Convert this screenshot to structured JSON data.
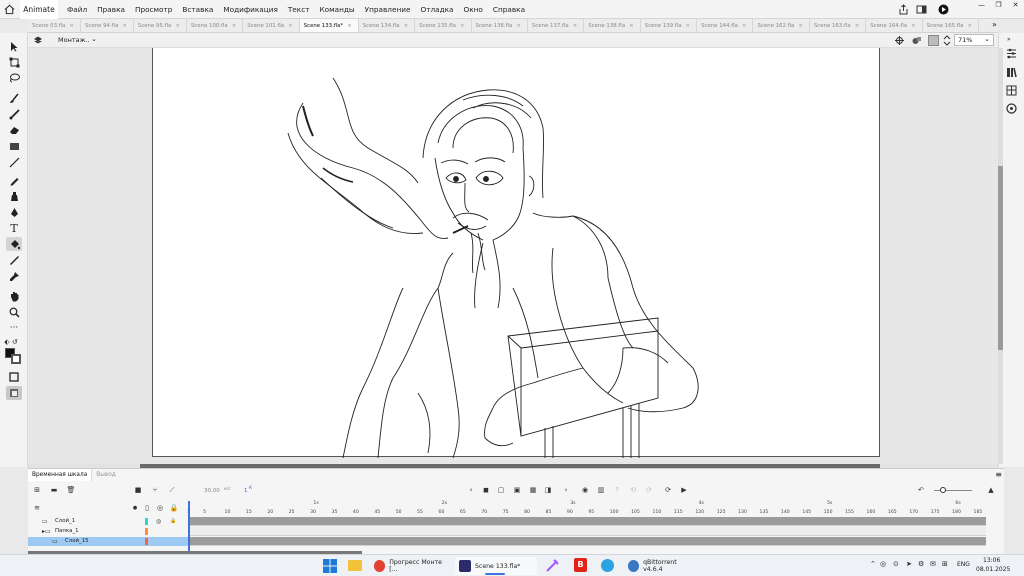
{
  "app": {
    "name": "Animate"
  },
  "menu": [
    "Файл",
    "Правка",
    "Просмотр",
    "Вставка",
    "Модификация",
    "Текст",
    "Команды",
    "Управление",
    "Отладка",
    "Окно",
    "Справка"
  ],
  "tabs": [
    {
      "label": "Scene 03.fla",
      "active": false
    },
    {
      "label": "Scene 94.fla",
      "active": false
    },
    {
      "label": "Scene 95.fla",
      "active": false
    },
    {
      "label": "Scene 100.fla",
      "active": false
    },
    {
      "label": "Scene 101.fla",
      "active": false
    },
    {
      "label": "Scene 133.fla*",
      "active": true
    },
    {
      "label": "Scene 134.fla",
      "active": false
    },
    {
      "label": "Scene 135.fla",
      "active": false
    },
    {
      "label": "Scene 136.fla",
      "active": false
    },
    {
      "label": "Scene 137.fla",
      "active": false
    },
    {
      "label": "Scene 138.fla",
      "active": false
    },
    {
      "label": "Scene 139.fla",
      "active": false
    },
    {
      "label": "Scene 144.fla",
      "active": false
    },
    {
      "label": "Scene 162.fla",
      "active": false
    },
    {
      "label": "Scene 163.fla",
      "active": false
    },
    {
      "label": "Scene 164.fla",
      "active": false
    },
    {
      "label": "Scene 165.fla",
      "active": false
    }
  ],
  "tab_close": "×",
  "tab_more": "»",
  "editbar": {
    "scene_label": "Монтаж..",
    "zoom": "71%"
  },
  "timeline": {
    "tabs": [
      "Временная шкала",
      "Вывод"
    ],
    "fps": "30,00",
    "fps_unit": "к/с",
    "frame": "1",
    "frame_unit": "К",
    "seconds": [
      "1s",
      "2s",
      "3s",
      "4s",
      "5s",
      "6s"
    ],
    "ticks": [
      "1",
      "5",
      "10",
      "15",
      "20",
      "25",
      "30",
      "35",
      "40",
      "45",
      "50",
      "55",
      "60",
      "65",
      "70",
      "75",
      "80",
      "85",
      "90",
      "95",
      "100",
      "105",
      "110",
      "115",
      "120",
      "125",
      "130",
      "135",
      "140",
      "145",
      "150",
      "155",
      "160",
      "165",
      "170",
      "175",
      "180",
      "185"
    ],
    "layers": [
      {
        "name": "Слой_1",
        "color": "#2fd7d2",
        "selected": false,
        "indent": 0
      },
      {
        "name": "Папка_1",
        "color": "#ff8e3c",
        "selected": false,
        "indent": 0
      },
      {
        "name": "Слой_15",
        "color": "#ff5e44",
        "selected": true,
        "indent": 1
      }
    ]
  },
  "taskbar": {
    "apps": [
      {
        "label": "Прогресс Монте [...",
        "icon": "chrome-icon",
        "active": false
      },
      {
        "label": "Scene 133.fla*",
        "icon": "animate-icon",
        "active": true
      },
      {
        "label": "qBittorrent v4.6.4",
        "icon": "qbittorrent-icon",
        "active": false
      }
    ],
    "lang": "ENG",
    "time": "13:06",
    "date": "08.01.2025"
  },
  "colors": {
    "accent": "#3e73d9",
    "animate_icon": "#2b2b6b",
    "selected_layer": "#9ec9f3"
  }
}
